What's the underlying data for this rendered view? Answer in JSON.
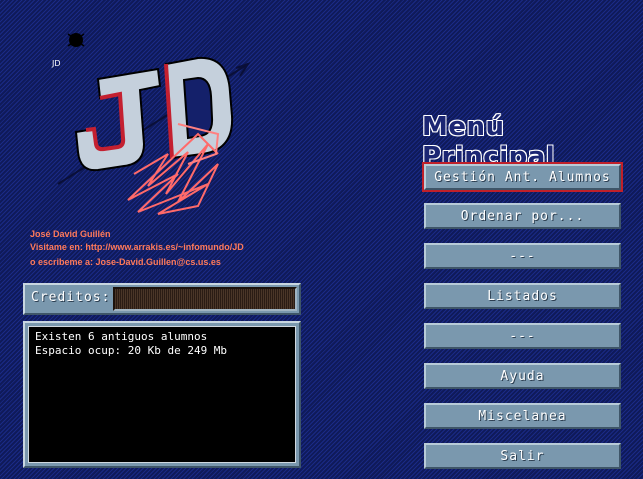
{
  "author": {
    "name": "José David Guillén",
    "visit": "Visitame en: http://www.arrakis.es/~infomundo/JD",
    "email": "o escribeme a: Jose-David.Guillen@cs.us.es"
  },
  "logo": {
    "text": "JD"
  },
  "menu": {
    "title": "Menú Principal",
    "buttons": [
      {
        "label": "Gestión Ant. Alumnos"
      },
      {
        "label": "Ordenar por..."
      },
      {
        "label": "---"
      },
      {
        "label": "Listados"
      },
      {
        "label": "---"
      },
      {
        "label": "Ayuda"
      },
      {
        "label": "Miscelanea"
      },
      {
        "label": "Salir"
      }
    ]
  },
  "credits": {
    "label": "Creditos:"
  },
  "console": {
    "lines": [
      "Existen 6 antiguos alumnos",
      "Espacio ocup: 20 Kb de 249 Mb"
    ]
  },
  "colors": {
    "background": "#14206a",
    "button": "#7a98ae",
    "accent": "#c0202a",
    "author_text": "#ff7a5a"
  }
}
